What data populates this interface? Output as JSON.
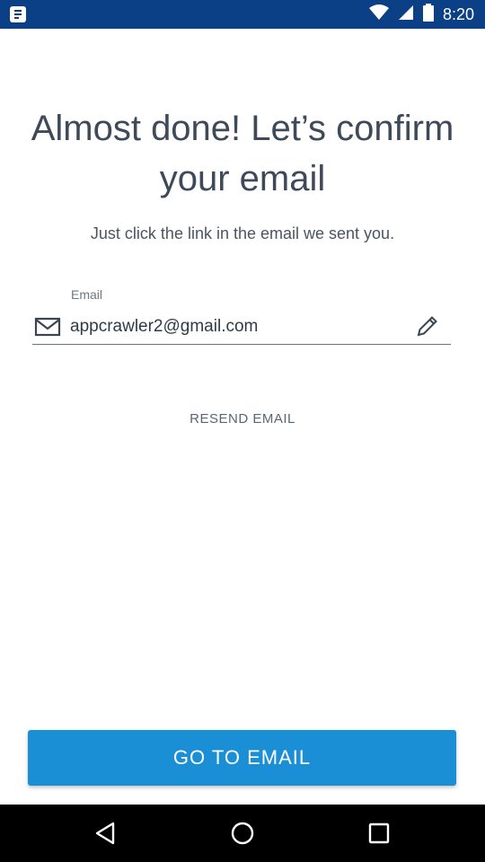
{
  "status_bar": {
    "time": "8:20",
    "icons": [
      "app-notification-icon",
      "wifi-icon",
      "cellular-signal-icon",
      "battery-icon"
    ]
  },
  "screen": {
    "title": "Almost done! Let’s confirm your email",
    "subtitle": "Just click the link in the email we sent you.",
    "email_label": "Email",
    "email_value": "appcrawler2@gmail.com",
    "resend_label": "RESEND EMAIL",
    "primary_button": "GO TO EMAIL"
  },
  "colors": {
    "status_bar": "#0b3f86",
    "accent": "#1a8fd6",
    "title_text": "#3e4a59"
  },
  "nav_bar": {
    "buttons": [
      "back-icon",
      "home-icon",
      "recent-apps-icon"
    ]
  }
}
